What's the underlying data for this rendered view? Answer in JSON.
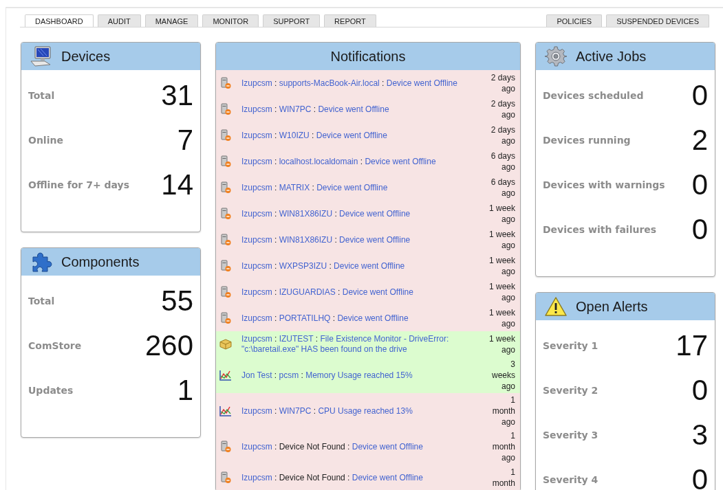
{
  "tabs_left": [
    {
      "label": "DASHBOARD",
      "selected": true
    },
    {
      "label": "AUDIT",
      "selected": false
    },
    {
      "label": "MANAGE",
      "selected": false
    },
    {
      "label": "MONITOR",
      "selected": false
    },
    {
      "label": "SUPPORT",
      "selected": false
    },
    {
      "label": "REPORT",
      "selected": false
    }
  ],
  "tabs_right": [
    {
      "label": "POLICIES",
      "selected": false
    },
    {
      "label": "SUSPENDED DEVICES",
      "selected": false
    }
  ],
  "devices": {
    "title": "Devices",
    "stats": [
      {
        "label": "Total",
        "value": "31"
      },
      {
        "label": "Online",
        "value": "7"
      },
      {
        "label": "Offline for 7+ days",
        "value": "14"
      }
    ]
  },
  "components": {
    "title": "Components",
    "stats": [
      {
        "label": "Total",
        "value": "55"
      },
      {
        "label": "ComStore",
        "value": "260"
      },
      {
        "label": "Updates",
        "value": "1"
      }
    ]
  },
  "notifications": {
    "title": "Notifications",
    "items": [
      {
        "kind": "offline",
        "color": "#f7e4e4",
        "source": "Izupcsm",
        "separator": ":",
        "device": "supports-MacBook-Air.local",
        "device_linked": true,
        "message": "Device went Offline",
        "time": "2 days ago"
      },
      {
        "kind": "offline",
        "color": "#f7e4e4",
        "source": "Izupcsm",
        "separator": ":",
        "device": "WIN7PC",
        "device_linked": true,
        "message": "Device went Offline",
        "time": "2 days ago"
      },
      {
        "kind": "offline",
        "color": "#f7e4e4",
        "source": "Izupcsm",
        "separator": ":",
        "device": "W10IZU",
        "device_linked": true,
        "message": "Device went Offline",
        "time": "2 days ago"
      },
      {
        "kind": "offline",
        "color": "#f7e4e4",
        "source": "Izupcsm",
        "separator": ":",
        "device": "localhost.localdomain",
        "device_linked": true,
        "message": "Device went Offline",
        "time": "6 days ago"
      },
      {
        "kind": "offline",
        "color": "#f7e4e4",
        "source": "Izupcsm",
        "separator": ":",
        "device": "MATRIX",
        "device_linked": true,
        "message": "Device went Offline",
        "time": "6 days ago"
      },
      {
        "kind": "offline",
        "color": "#f7e4e4",
        "source": "Izupcsm",
        "separator": ":",
        "device": "WIN81X86IZU",
        "device_linked": true,
        "message": "Device went Offline",
        "time": "1 week ago"
      },
      {
        "kind": "offline",
        "color": "#f7e4e4",
        "source": "Izupcsm",
        "separator": ":",
        "device": "WIN81X86IZU",
        "device_linked": true,
        "message": "Device went Offline",
        "time": "1 week ago"
      },
      {
        "kind": "offline",
        "color": "#f7e4e4",
        "source": "Izupcsm",
        "separator": ":",
        "device": "WXPSP3IZU",
        "device_linked": true,
        "message": "Device went Offline",
        "time": "1 week ago"
      },
      {
        "kind": "offline",
        "color": "#f7e4e4",
        "source": "Izupcsm",
        "separator": ":",
        "device": "IZUGUARDIAS",
        "device_linked": true,
        "message": "Device went Offline",
        "time": "1 week ago"
      },
      {
        "kind": "offline",
        "color": "#f7e4e4",
        "source": "Izupcsm",
        "separator": ":",
        "device": "PORTATILHQ",
        "device_linked": true,
        "message": "Device went Offline",
        "time": "1 week ago"
      },
      {
        "kind": "file",
        "color": "#dcfccf",
        "source": "Izupcsm",
        "separator": ":",
        "device": "IZUTEST",
        "device_linked": true,
        "message": "File Existence Monitor - DriveError: \"c:\\baretail.exe\" HAS been found on the drive",
        "time": "1 week ago"
      },
      {
        "kind": "performance",
        "color": "#dcfccf",
        "source": "Jon Test",
        "separator": ":",
        "device": "pcsm",
        "device_linked": true,
        "message": "Memory Usage reached 15%",
        "time": "3 weeks ago"
      },
      {
        "kind": "performance",
        "color": "#f7e4e4",
        "source": "Izupcsm",
        "separator": ":",
        "device": "WIN7PC",
        "device_linked": true,
        "message": "CPU Usage reached 13%",
        "time": "1 month ago"
      },
      {
        "kind": "offline",
        "color": "#f7e4e4",
        "source": "Izupcsm",
        "separator": ":",
        "device": "Device Not Found",
        "device_linked": false,
        "message": "Device went Offline",
        "time": "1 month ago"
      },
      {
        "kind": "offline",
        "color": "#f7e4e4",
        "source": "Izupcsm",
        "separator": ":",
        "device": "Device Not Found",
        "device_linked": false,
        "message": "Device went Offline",
        "time": "1 month"
      }
    ]
  },
  "active_jobs": {
    "title": "Active Jobs",
    "stats": [
      {
        "label": "Devices scheduled",
        "value": "0"
      },
      {
        "label": "Devices running",
        "value": "2"
      },
      {
        "label": "Devices with warnings",
        "value": "0"
      },
      {
        "label": "Devices with failures",
        "value": "0"
      }
    ]
  },
  "open_alerts": {
    "title": "Open Alerts",
    "stats": [
      {
        "label": "Severity 1",
        "value": "17"
      },
      {
        "label": "Severity 2",
        "value": "0"
      },
      {
        "label": "Severity 3",
        "value": "3"
      },
      {
        "label": "Severity 4",
        "value": "0"
      }
    ]
  }
}
